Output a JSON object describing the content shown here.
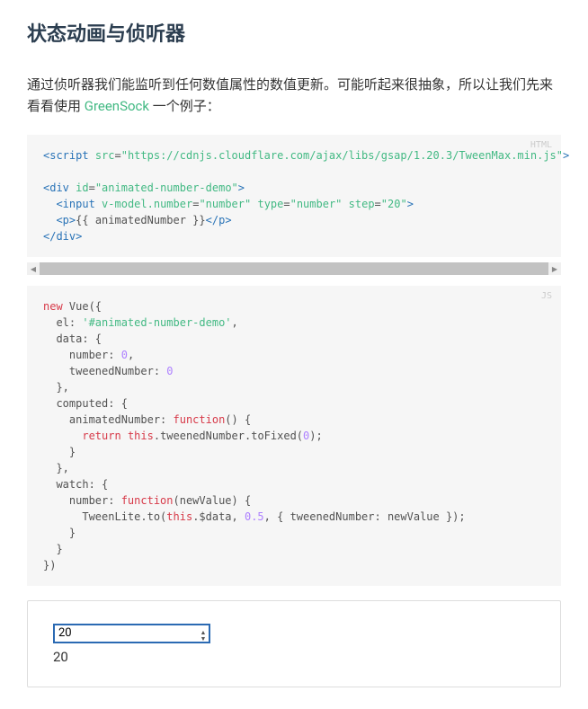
{
  "title": "状态动画与侦听器",
  "intro_pre": "通过侦听器我们能监听到任何数值属性的数值更新。可能听起来很抽象，所以让我们先来看看使用 ",
  "intro_link": "GreenSock",
  "intro_post": " 一个例子：",
  "code1": {
    "lang": "HTML",
    "tokens": [
      [
        "t-tag",
        "<script"
      ],
      [
        "t-plain",
        " "
      ],
      [
        "t-attr",
        "src"
      ],
      [
        "t-plain",
        "="
      ],
      [
        "t-str",
        "\"https://cdnjs.cloudflare.com/ajax/libs/gsap/1.20.3/TweenMax.min.js\""
      ],
      [
        "t-tag",
        ">"
      ],
      [
        "t-plain",
        "\n\n"
      ],
      [
        "t-tag",
        "<div"
      ],
      [
        "t-plain",
        " "
      ],
      [
        "t-attr",
        "id"
      ],
      [
        "t-plain",
        "="
      ],
      [
        "t-str",
        "\"animated-number-demo\""
      ],
      [
        "t-tag",
        ">"
      ],
      [
        "t-plain",
        "\n  "
      ],
      [
        "t-tag",
        "<input"
      ],
      [
        "t-plain",
        " "
      ],
      [
        "t-attr",
        "v-model.number"
      ],
      [
        "t-plain",
        "="
      ],
      [
        "t-str",
        "\"number\""
      ],
      [
        "t-plain",
        " "
      ],
      [
        "t-attr",
        "type"
      ],
      [
        "t-plain",
        "="
      ],
      [
        "t-str",
        "\"number\""
      ],
      [
        "t-plain",
        " "
      ],
      [
        "t-attr",
        "step"
      ],
      [
        "t-plain",
        "="
      ],
      [
        "t-str",
        "\"20\""
      ],
      [
        "t-tag",
        ">"
      ],
      [
        "t-plain",
        "\n  "
      ],
      [
        "t-tag",
        "<p>"
      ],
      [
        "t-plain",
        "{{ animatedNumber }}"
      ],
      [
        "t-tag",
        "</p>"
      ],
      [
        "t-plain",
        "\n"
      ],
      [
        "t-tag",
        "</div>"
      ]
    ]
  },
  "code2": {
    "lang": "JS",
    "tokens": [
      [
        "t-kw",
        "new"
      ],
      [
        "t-plain",
        " Vue({\n  el: "
      ],
      [
        "t-str",
        "'#animated-number-demo'"
      ],
      [
        "t-plain",
        ",\n  data: {\n    number: "
      ],
      [
        "t-num",
        "0"
      ],
      [
        "t-plain",
        ",\n    tweenedNumber: "
      ],
      [
        "t-num",
        "0"
      ],
      [
        "t-plain",
        "\n  },\n  computed: {\n    animatedNumber: "
      ],
      [
        "t-kw",
        "function"
      ],
      [
        "t-plain",
        "() {\n      "
      ],
      [
        "t-kw",
        "return"
      ],
      [
        "t-plain",
        " "
      ],
      [
        "t-kw",
        "this"
      ],
      [
        "t-plain",
        ".tweenedNumber.toFixed("
      ],
      [
        "t-num",
        "0"
      ],
      [
        "t-plain",
        ");\n    }\n  },\n  watch: {\n    number: "
      ],
      [
        "t-kw",
        "function"
      ],
      [
        "t-plain",
        "(newValue) {\n      TweenLite.to("
      ],
      [
        "t-kw",
        "this"
      ],
      [
        "t-plain",
        ".$data, "
      ],
      [
        "t-num",
        "0.5"
      ],
      [
        "t-plain",
        ", { tweenedNumber: newValue });\n    }\n  }\n})"
      ]
    ]
  },
  "demo": {
    "input_value": "20",
    "output_value": "20"
  }
}
